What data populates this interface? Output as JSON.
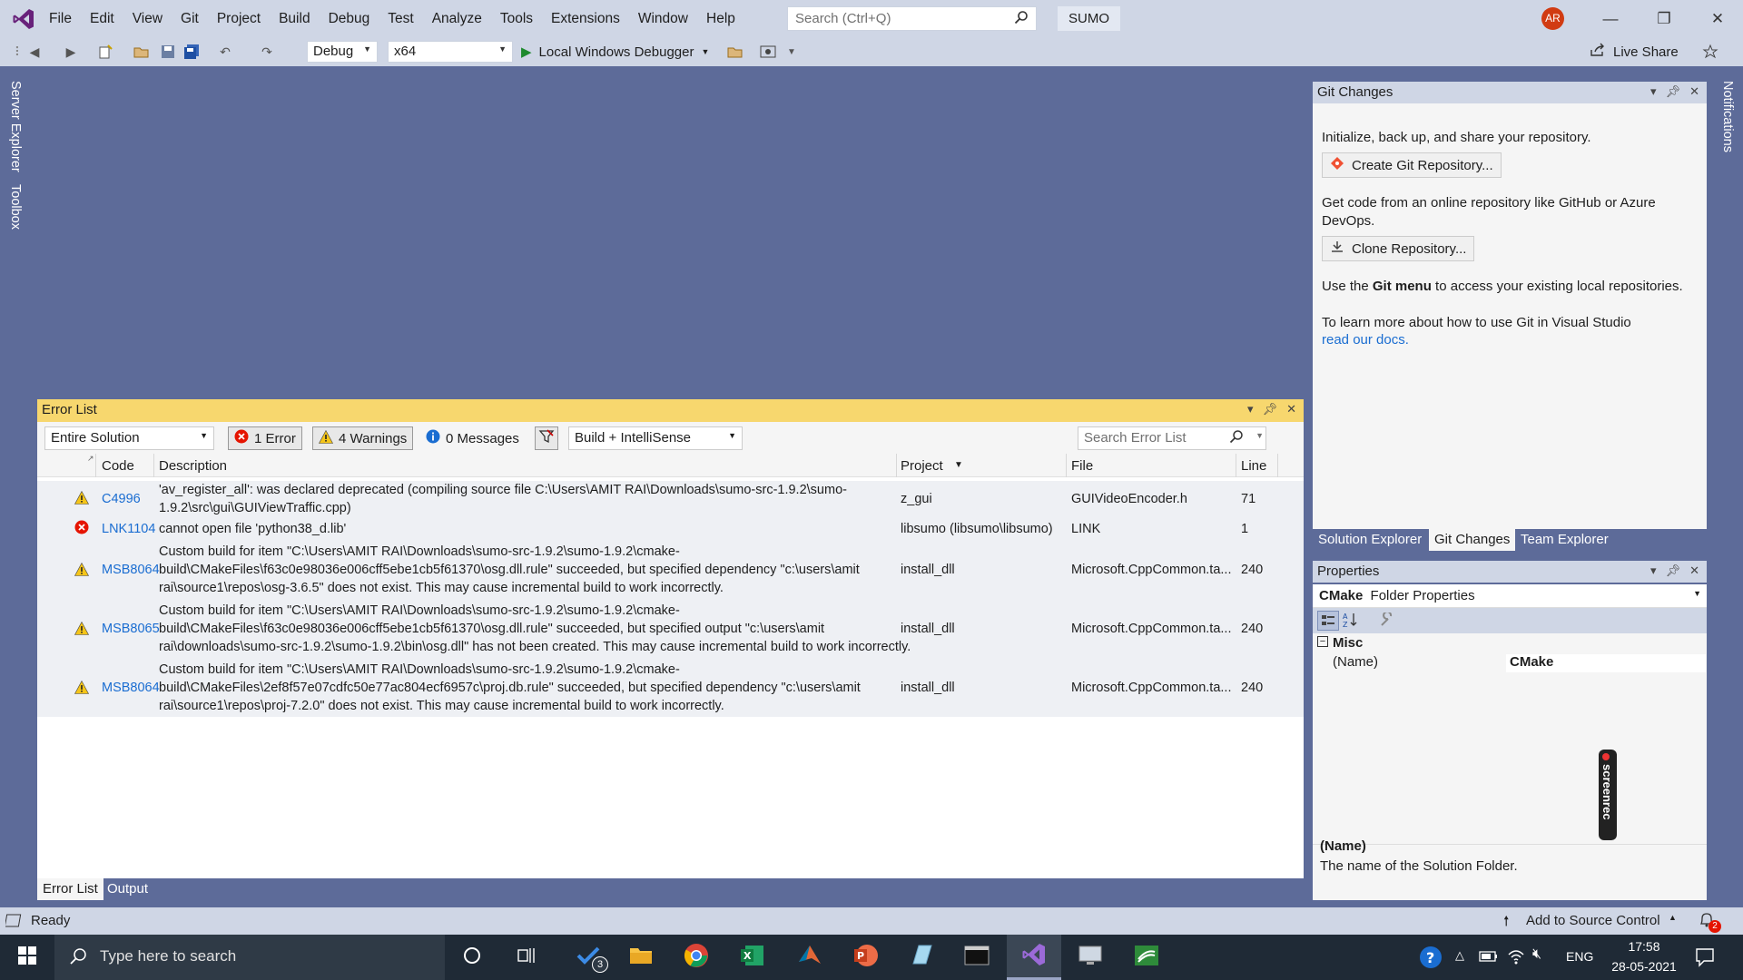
{
  "menu": {
    "items": [
      "File",
      "Edit",
      "View",
      "Git",
      "Project",
      "Build",
      "Debug",
      "Test",
      "Analyze",
      "Tools",
      "Extensions",
      "Window",
      "Help"
    ],
    "search_placeholder": "Search (Ctrl+Q)",
    "solution_name": "SUMO",
    "avatar_initials": "AR"
  },
  "toolbar": {
    "config": "Debug",
    "platform": "x64",
    "debugger": "Local Windows Debugger",
    "live_share": "Live Share"
  },
  "side_tabs": {
    "left": [
      "Server Explorer",
      "Toolbox"
    ],
    "right": "Notifications"
  },
  "git_changes": {
    "title": "Git Changes",
    "intro": "Initialize, back up, and share your repository.",
    "create_btn": "Create Git Repository...",
    "online_text": "Get code from an online repository like GitHub or Azure DevOps.",
    "clone_btn": "Clone Repository...",
    "menu_text_pre": "Use the ",
    "menu_text_bold": "Git menu",
    "menu_text_post": " to access your existing local repositories.",
    "learn_text": "To learn more about how to use Git in Visual Studio",
    "learn_link": "read our docs.",
    "tabs": [
      "Solution Explorer",
      "Git Changes",
      "Team Explorer"
    ]
  },
  "properties": {
    "title": "Properties",
    "object_name": "CMake",
    "object_type": "Folder Properties",
    "category": "Misc",
    "prop_name": "(Name)",
    "prop_value": "CMake",
    "desc_title": "(Name)",
    "desc_text": "The name of the Solution Folder.",
    "watermark": "screenrec"
  },
  "error_list": {
    "title": "Error List",
    "scope": "Entire Solution",
    "errors_label": "1 Error",
    "warnings_label": "4 Warnings",
    "messages_label": "0 Messages",
    "source": "Build + IntelliSense",
    "search_placeholder": "Search Error List",
    "columns": [
      "Code",
      "Description",
      "Project",
      "File",
      "Line"
    ],
    "rows": [
      {
        "type": "warning",
        "code": "C4996",
        "description": "'av_register_all': was declared deprecated (compiling source file C:\\Users\\AMIT RAI\\Downloads\\sumo-src-1.9.2\\sumo-1.9.2\\src\\gui\\GUIViewTraffic.cpp)",
        "project": "z_gui",
        "file": "GUIVideoEncoder.h",
        "line": "71"
      },
      {
        "type": "error",
        "code": "LNK1104",
        "description": "cannot open file 'python38_d.lib'",
        "project": "libsumo (libsumo\\libsumo)",
        "file": "LINK",
        "line": "1"
      },
      {
        "type": "warning",
        "code": "MSB8064",
        "description": "Custom build for item \"C:\\Users\\AMIT RAI\\Downloads\\sumo-src-1.9.2\\sumo-1.9.2\\cmake-build\\CMakeFiles\\f63c0e98036e006cff5ebe1cb5f61370\\osg.dll.rule\" succeeded, but specified dependency \"c:\\users\\amit rai\\source1\\repos\\osg-3.6.5\" does not exist. This may cause incremental build to work incorrectly.",
        "project": "install_dll",
        "file": "Microsoft.CppCommon.ta...",
        "line": "240"
      },
      {
        "type": "warning",
        "code": "MSB8065",
        "description": "Custom build for item \"C:\\Users\\AMIT RAI\\Downloads\\sumo-src-1.9.2\\sumo-1.9.2\\cmake-build\\CMakeFiles\\f63c0e98036e006cff5ebe1cb5f61370\\osg.dll.rule\" succeeded, but specified output \"c:\\users\\amit rai\\downloads\\sumo-src-1.9.2\\sumo-1.9.2\\bin\\osg.dll\" has not been created. This may cause incremental build to work incorrectly.",
        "project": "install_dll",
        "file": "Microsoft.CppCommon.ta...",
        "line": "240"
      },
      {
        "type": "warning",
        "code": "MSB8064",
        "description": "Custom build for item \"C:\\Users\\AMIT RAI\\Downloads\\sumo-src-1.9.2\\sumo-1.9.2\\cmake-build\\CMakeFiles\\2ef8f57e07cdfc50e77ac804ecf6957c\\proj.db.rule\" succeeded, but specified dependency \"c:\\users\\amit rai\\source1\\repos\\proj-7.2.0\" does not exist. This may cause incremental build to work incorrectly.",
        "project": "install_dll",
        "file": "Microsoft.CppCommon.ta...",
        "line": "240"
      }
    ],
    "tabs": [
      "Error List",
      "Output"
    ]
  },
  "statusbar": {
    "status": "Ready",
    "source_control": "Add to Source Control",
    "notification_count": "2"
  },
  "taskbar": {
    "search_placeholder": "Type here to search",
    "time": "17:58",
    "date": "28-05-2021",
    "lang": "ENG",
    "todo_badge": "3"
  }
}
